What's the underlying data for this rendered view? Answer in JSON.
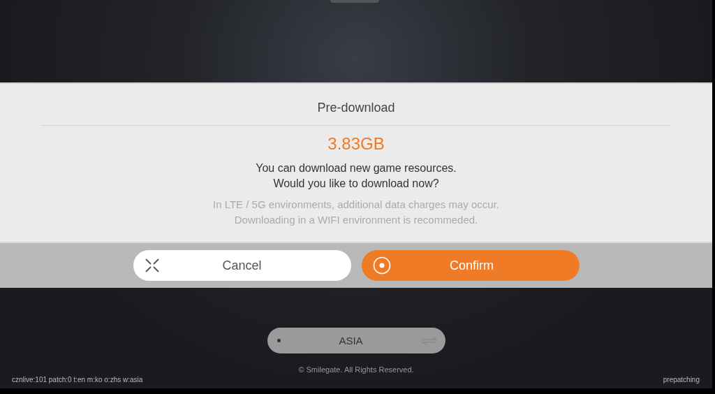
{
  "dialog": {
    "title": "Pre-download",
    "size": "3.83GB",
    "message": [
      "You can download new game resources.",
      "Would you like to download now?"
    ],
    "notice": [
      "In LTE / 5G environments, additional data charges may occur.",
      "Downloading in a WIFI environment is recommeded."
    ],
    "buttons": [
      {
        "kind": "cancel",
        "label": "Cancel"
      },
      {
        "kind": "confirm",
        "label": "Confirm"
      }
    ]
  },
  "region": {
    "label": "ASIA"
  },
  "copyright": "© Smilegate. All Rights Reserved.",
  "status_bar": {
    "build_info": "cznlive:101 patch:0 t:en m:ko o:zhs w:asia",
    "state": "prepatching"
  }
}
